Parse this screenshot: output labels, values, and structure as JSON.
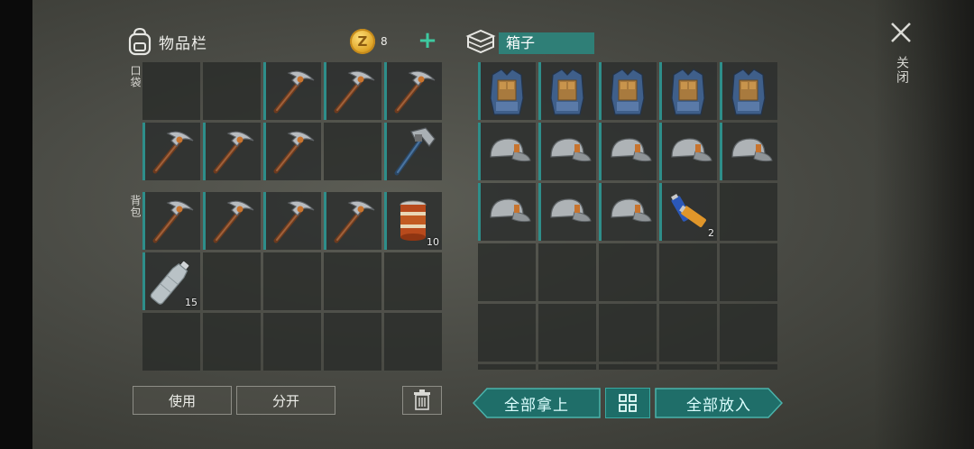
{
  "inventory": {
    "title": "物品栏",
    "coins": "8",
    "pocket_label": "口袋",
    "backpack_label": "背包",
    "pocket": [
      {
        "item": "",
        "qty": ""
      },
      {
        "item": "",
        "qty": ""
      },
      {
        "item": "pickaxe",
        "qty": ""
      },
      {
        "item": "pickaxe",
        "qty": ""
      },
      {
        "item": "pickaxe",
        "qty": ""
      },
      {
        "item": "pickaxe",
        "qty": ""
      },
      {
        "item": "pickaxe",
        "qty": ""
      },
      {
        "item": "pickaxe",
        "qty": ""
      },
      {
        "item": "",
        "qty": ""
      },
      {
        "item": "hatchet",
        "qty": ""
      }
    ],
    "backpack": [
      {
        "item": "pickaxe",
        "qty": ""
      },
      {
        "item": "pickaxe",
        "qty": ""
      },
      {
        "item": "pickaxe",
        "qty": ""
      },
      {
        "item": "pickaxe",
        "qty": ""
      },
      {
        "item": "canned-food",
        "qty": "10"
      },
      {
        "item": "water-bottle",
        "qty": "15"
      },
      {
        "item": "",
        "qty": ""
      },
      {
        "item": "",
        "qty": ""
      },
      {
        "item": "",
        "qty": ""
      },
      {
        "item": "",
        "qty": ""
      },
      {
        "item": "",
        "qty": ""
      },
      {
        "item": "",
        "qty": ""
      },
      {
        "item": "",
        "qty": ""
      },
      {
        "item": "",
        "qty": ""
      },
      {
        "item": "",
        "qty": ""
      }
    ],
    "use_button": "使用",
    "split_button": "分开"
  },
  "box": {
    "title": "箱子",
    "slots": [
      {
        "item": "armor-vest",
        "qty": ""
      },
      {
        "item": "armor-vest",
        "qty": ""
      },
      {
        "item": "armor-vest",
        "qty": ""
      },
      {
        "item": "armor-vest",
        "qty": ""
      },
      {
        "item": "armor-vest",
        "qty": ""
      },
      {
        "item": "cap",
        "qty": ""
      },
      {
        "item": "cap",
        "qty": ""
      },
      {
        "item": "cap",
        "qty": ""
      },
      {
        "item": "cap",
        "qty": ""
      },
      {
        "item": "cap",
        "qty": ""
      },
      {
        "item": "cap",
        "qty": ""
      },
      {
        "item": "cap",
        "qty": ""
      },
      {
        "item": "cap",
        "qty": ""
      },
      {
        "item": "batteries",
        "qty": "2"
      },
      {
        "item": "",
        "qty": ""
      },
      {
        "item": "",
        "qty": ""
      },
      {
        "item": "",
        "qty": ""
      },
      {
        "item": "",
        "qty": ""
      },
      {
        "item": "",
        "qty": ""
      },
      {
        "item": "",
        "qty": ""
      },
      {
        "item": "",
        "qty": ""
      },
      {
        "item": "",
        "qty": ""
      },
      {
        "item": "",
        "qty": ""
      },
      {
        "item": "",
        "qty": ""
      },
      {
        "item": "",
        "qty": ""
      },
      {
        "item": "",
        "qty": ""
      },
      {
        "item": "",
        "qty": ""
      },
      {
        "item": "",
        "qty": ""
      },
      {
        "item": "",
        "qty": ""
      },
      {
        "item": "",
        "qty": ""
      }
    ],
    "take_all": "全部拿上",
    "put_all": "全部放入"
  },
  "close_label": "关闭",
  "colors": {
    "accent": "#2e8e8a",
    "coin": "#e0a72a",
    "plus": "#3ec9a0"
  }
}
